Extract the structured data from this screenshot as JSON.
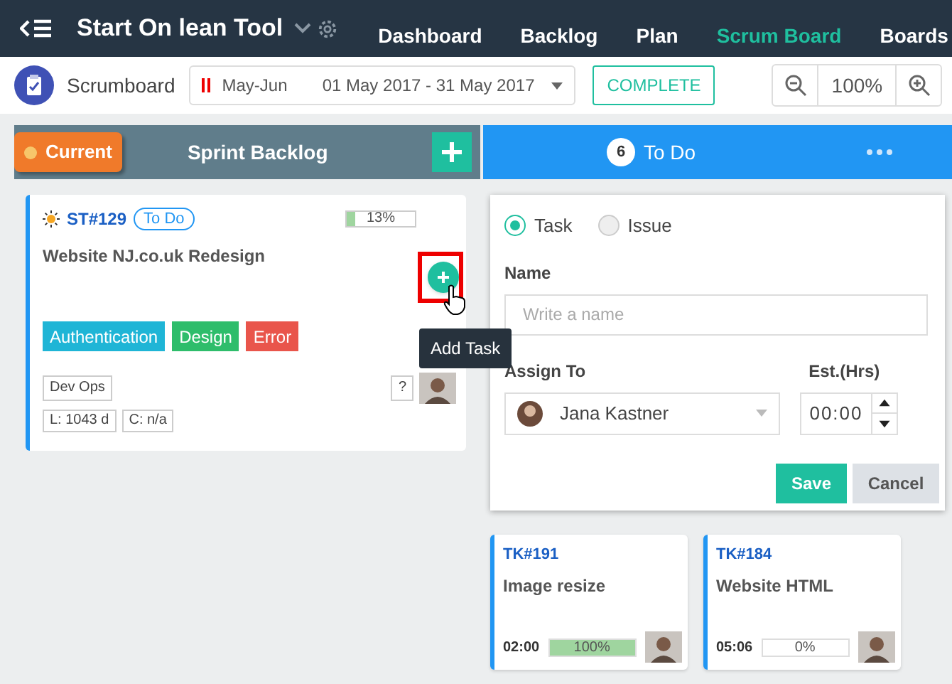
{
  "nav": {
    "app_title": "Start On lean Tool",
    "items": [
      {
        "label": "Dashboard",
        "selected": false
      },
      {
        "label": "Backlog",
        "selected": false
      },
      {
        "label": "Plan",
        "selected": false
      },
      {
        "label": "Scrum Board",
        "selected": true
      },
      {
        "label": "Boards",
        "selected": false
      }
    ]
  },
  "toolbar": {
    "title": "Scrumboard",
    "sprint": {
      "name": "May-Jun",
      "range": "01 May 2017 - 31 May 2017"
    },
    "complete_button": "COMPLETE",
    "zoom": "100%"
  },
  "sprint_backlog": {
    "badge": "Current",
    "title": "Sprint Backlog",
    "story": {
      "id": "ST#129",
      "status": "To Do",
      "level": 0.13,
      "reading": "13%",
      "title": "Website NJ.co.uk Redesign",
      "tags": [
        {
          "label": "Authentication",
          "color": "#1fb5d6"
        },
        {
          "label": "Design",
          "color": "#2ebd6b"
        },
        {
          "label": "Error",
          "color": "#e9554b"
        }
      ],
      "team": "Dev Ops",
      "unknown": "?",
      "lead_time": "L: 1043 d",
      "cycle_time": "C: n/a"
    },
    "tooltip": "Add Task"
  },
  "todo": {
    "count": "6",
    "title": "To Do",
    "form": {
      "types": [
        {
          "label": "Task",
          "selected": true
        },
        {
          "label": "Issue",
          "selected": false
        }
      ],
      "name_label": "Name",
      "name_placeholder": "Write a name",
      "assign_label": "Assign To",
      "assignee": "Jana Kastner",
      "est_label": "Est.(Hrs)",
      "est_value": "00:00",
      "save": "Save",
      "cancel": "Cancel"
    },
    "tasks": [
      {
        "id": "TK#191",
        "title": "Image resize",
        "time": "02:00",
        "level": 1.0,
        "reading": "100%"
      },
      {
        "id": "TK#184",
        "title": "Website HTML",
        "time": "05:06",
        "level": 0.0,
        "reading": "0%"
      }
    ]
  }
}
